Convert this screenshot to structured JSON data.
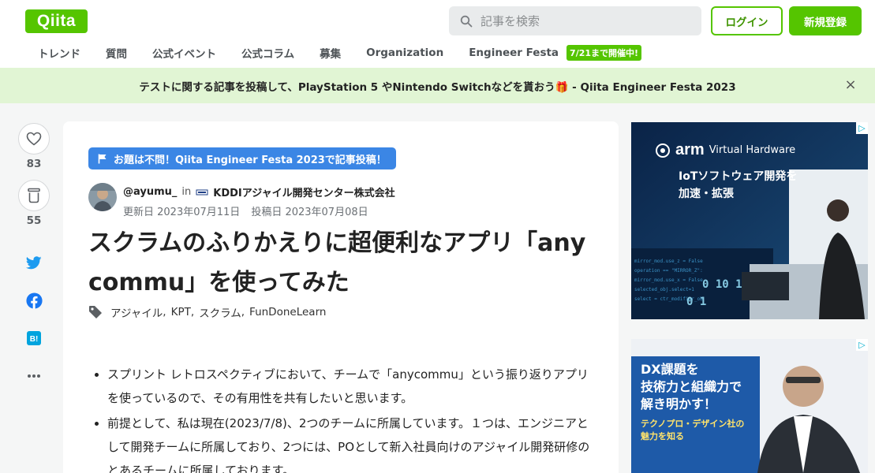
{
  "header": {
    "logo": "Qiita",
    "search_placeholder": "記事を検索",
    "login": "ログイン",
    "signup": "新規登録",
    "nav": [
      "トレンド",
      "質問",
      "公式イベント",
      "公式コラム",
      "募集",
      "Organization",
      "Engineer Festa"
    ],
    "nav_badge": "7/21まで開催中!"
  },
  "banner": {
    "text": "テストに関する記事を投稿して、PlayStation 5 やNintendo Switchなどを貰おう🎁 - Qiita Engineer Festa 2023",
    "close": "×"
  },
  "rail": {
    "likes": "83",
    "stocks": "55"
  },
  "article": {
    "theme_tag": "お題は不問！Qiita Engineer Festa 2023で記事投稿！",
    "author": "@ayumu_",
    "in": "in",
    "organization": "KDDIアジャイル開発センター株式会社",
    "updated": "更新日 2023年07月11日",
    "posted": "投稿日 2023年07月08日",
    "title": "スクラムのふりかえりに超便利なアプリ「anycommu」を使ってみた",
    "tags": [
      "アジャイル",
      "KPT",
      "スクラム",
      "FunDoneLearn"
    ],
    "bullets": [
      "スプリント レトロスペクティブにおいて、チームで「anycommu」という振り返りアプリを使っているので、その有用性を共有したいと思います。",
      "前提として、私は現在(2023/7/8)、2つのチームに所属しています。１つは、エンジニアとして開発チームに所属しており、2つには、POとして新入社員向けのアジャイル開発研修のとあるチームに所属しております。"
    ]
  },
  "ads": {
    "ad1_brand": "arm",
    "ad1_product": "Virtual Hardware",
    "ad1_line1": "IoTソフトウェア開発を",
    "ad1_line2": "加速・拡張",
    "ad2_line1": "DX課題を",
    "ad2_line2": "技術力と組織力で",
    "ad2_line3": "解き明かす！",
    "ad2_line4": "テクノプロ・デザイン社の",
    "ad2_line5": "魅力を知る"
  }
}
